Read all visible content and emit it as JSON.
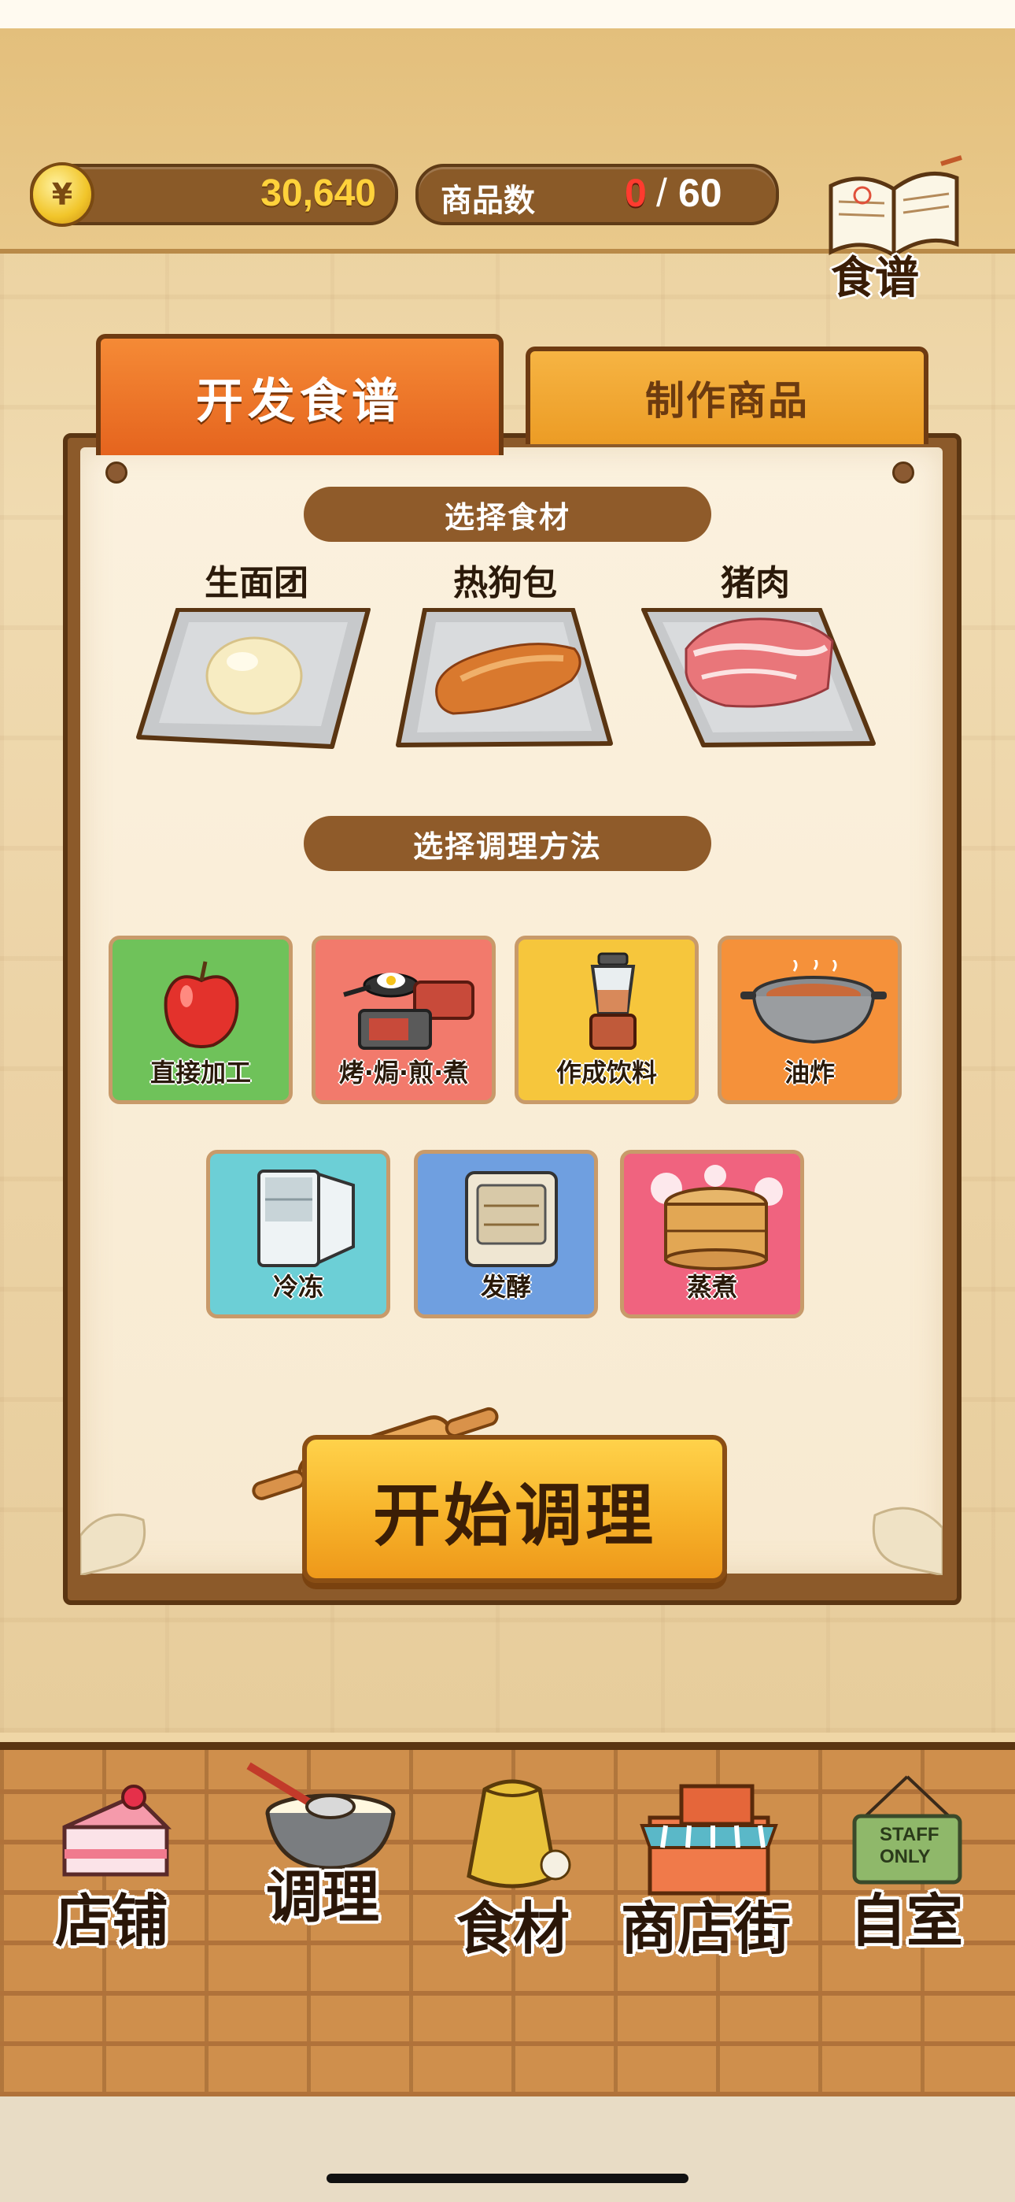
{
  "header": {
    "money": "30,640",
    "currency_symbol": "¥",
    "items_label": "商品数",
    "items_current": "0",
    "items_separator": "/",
    "items_max": "60",
    "recipe_book_label": "食谱"
  },
  "tabs": [
    {
      "label": "开发食谱",
      "active": true
    },
    {
      "label": "制作商品",
      "active": false
    }
  ],
  "ingredients_section": {
    "title": "选择食材",
    "items": [
      {
        "label": "生面团",
        "icon": "dough-icon"
      },
      {
        "label": "热狗包",
        "icon": "hotdog-bun-icon"
      },
      {
        "label": "猪肉",
        "icon": "pork-icon"
      }
    ]
  },
  "methods_section": {
    "title": "选择调理方法",
    "items": [
      {
        "label": "直接加工",
        "icon": "apple-icon",
        "color": "#6fc25a"
      },
      {
        "label": "烤·焗·煎·煮",
        "icon": "cookware-icon",
        "color": "#f27a6c"
      },
      {
        "label": "作成饮料",
        "icon": "blender-icon",
        "color": "#f6c63c"
      },
      {
        "label": "油炸",
        "icon": "fryer-pot-icon",
        "color": "#f5913a"
      },
      {
        "label": "冷冻",
        "icon": "refrigerator-icon",
        "color": "#6ccfd6"
      },
      {
        "label": "发酵",
        "icon": "proofing-box-icon",
        "color": "#6f9fe0"
      },
      {
        "label": "蒸煮",
        "icon": "steamer-icon",
        "color": "#f0637f"
      }
    ]
  },
  "start_button": {
    "label": "开始调理"
  },
  "bottom_nav": [
    {
      "label": "店铺",
      "icon": "cake-icon"
    },
    {
      "label": "调理",
      "icon": "whisk-bowl-icon"
    },
    {
      "label": "食材",
      "icon": "flour-sack-icon"
    },
    {
      "label": "商店街",
      "icon": "storefront-icon"
    },
    {
      "label": "自室",
      "icon": "staff-only-sign-icon"
    }
  ],
  "staff_sign_text": "STAFF ONLY",
  "colors": {
    "panel_wood": "#8c5a2a",
    "paper": "#fbf1de",
    "active_tab": "#f0772a",
    "inactive_tab": "#f2aa33",
    "money_text": "#ffd23b",
    "items_current_text": "#ff3b2f",
    "start_button": "#f7b32a"
  }
}
